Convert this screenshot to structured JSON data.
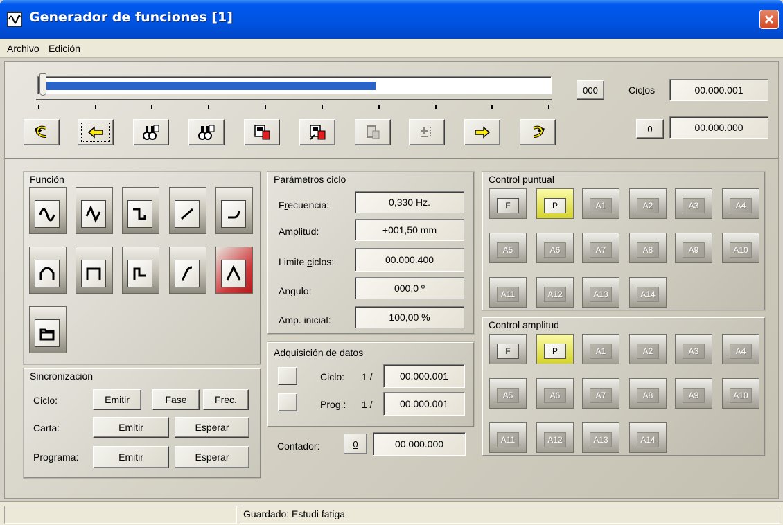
{
  "window": {
    "title": "Generador de funciones [1]"
  },
  "menu": [
    {
      "label": "Archivo",
      "underline": "A"
    },
    {
      "label": "Edición",
      "underline": "E"
    }
  ],
  "progress": {
    "fraction": 0.65
  },
  "top_fields": {
    "count_label": "000",
    "cycles_label": "Ciclos",
    "cycles_value": "00.000.001",
    "reset_label": "0",
    "reset_value": "00.000.000"
  },
  "toolbar": [
    "undo-yellow-icon",
    "back-arrow-icon",
    "binoculars-icon",
    "binoculars-alt-icon",
    "save-red-icon",
    "save-alt-icon",
    "disabled-doc-icon",
    "disabled-plus-icon",
    "forward-arrow-icon",
    "redo-yellow-icon"
  ],
  "funcion": {
    "label": "Función",
    "selected": "triangle-peak",
    "buttons": [
      "sine",
      "triangle",
      "square",
      "ramp-up",
      "curve",
      "half-sine",
      "pulse",
      "step-down",
      "s-ramp",
      "triangle-peak",
      "folder"
    ]
  },
  "parametros": {
    "label": "Parámetros ciclo",
    "rows": [
      {
        "label": "Frecuencia:",
        "value": "0,330 Hz."
      },
      {
        "label": "Amplitud:",
        "value": "+001,50 mm"
      },
      {
        "label": "Limite ciclos:",
        "value": "00.000.400"
      },
      {
        "label": "Angulo:",
        "value": "000,0 º"
      },
      {
        "label": "Amp. inicial:",
        "value": "100,00 %"
      }
    ]
  },
  "adquisicion": {
    "label": "Adquisición de datos",
    "rows": [
      {
        "label": "Ciclo:",
        "of": "1 /",
        "value": "00.000.001"
      },
      {
        "label": "Prog.:",
        "of": "1 /",
        "value": "00.000.001"
      }
    ]
  },
  "contador": {
    "label": "Contador:",
    "button": "0",
    "value": "00.000.000"
  },
  "sincronizacion": {
    "label": "Sincronización",
    "ciclo": {
      "label": "Ciclo:",
      "emit": "Emitir",
      "fase": "Fase",
      "frec": "Frec."
    },
    "carta": {
      "label": "Carta:",
      "emit": "Emitir",
      "wait": "Esperar"
    },
    "programa": {
      "label": "Programa:",
      "emit": "Emitir",
      "wait": "Esperar"
    }
  },
  "control_puntual": {
    "label": "Control puntual",
    "buttons": [
      "F",
      "P",
      "A1",
      "A2",
      "A3",
      "A4",
      "A5",
      "A6",
      "A7",
      "A8",
      "A9",
      "A10",
      "A11",
      "A12",
      "A13",
      "A14"
    ]
  },
  "control_amplitud": {
    "label": "Control amplitud",
    "buttons": [
      "F",
      "P",
      "A1",
      "A2",
      "A3",
      "A4",
      "A5",
      "A6",
      "A7",
      "A8",
      "A9",
      "A10",
      "A11",
      "A12",
      "A13",
      "A14"
    ]
  },
  "status": {
    "text": "Guardado: Estudi fatiga"
  }
}
